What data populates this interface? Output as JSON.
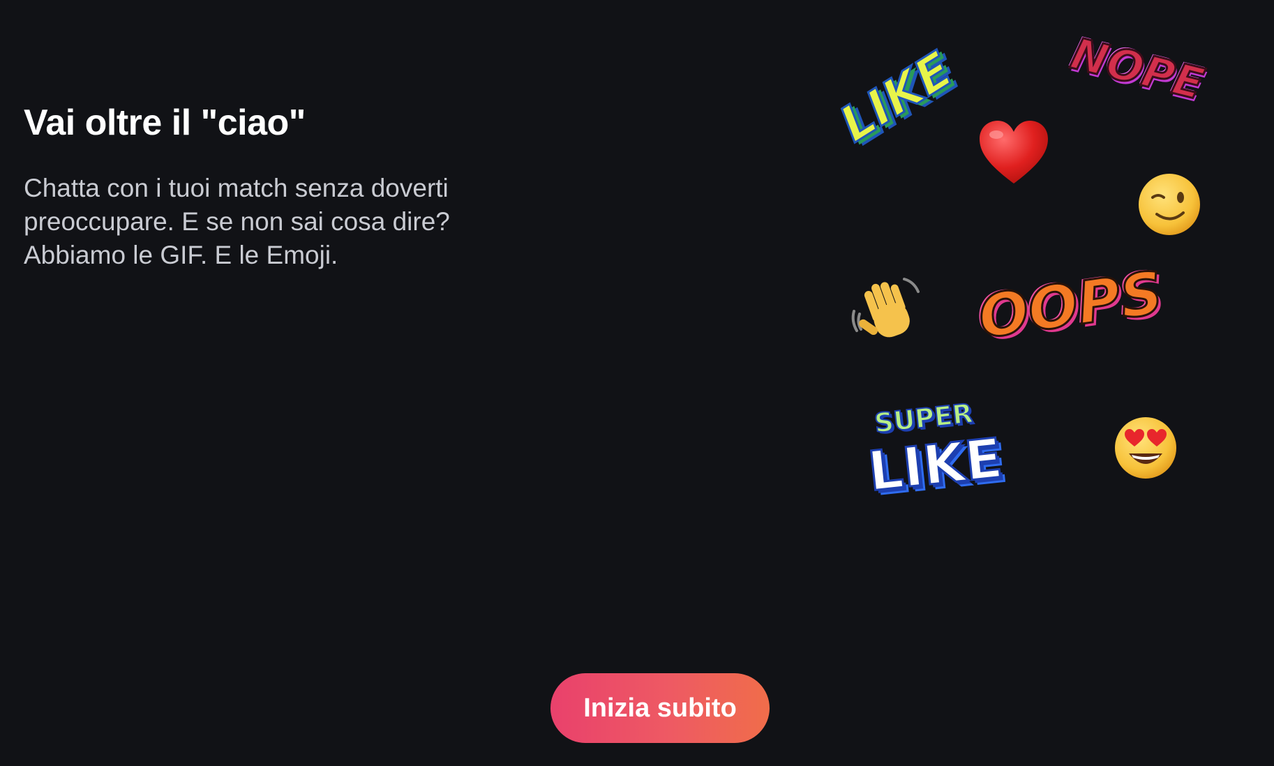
{
  "content": {
    "title": "Vai oltre il \"ciao\"",
    "description_line1": "Chatta con i tuoi match senza doverti",
    "description_line2": "preoccupare. E se non sai cosa dire?",
    "description_line3": "Abbiamo le GIF. E le Emoji."
  },
  "stickers": {
    "like": "LIKE",
    "nope": "NOPE",
    "oops": "OOPS",
    "super": "SUPER",
    "super_like": "LIKE",
    "icons": [
      "heart-icon",
      "wink-face-icon",
      "waving-hand-icon",
      "heart-eyes-face-icon"
    ]
  },
  "cta": {
    "label": "Inizia subito"
  },
  "colors": {
    "background": "#111216",
    "button_gradient_start": "#e9416c",
    "button_gradient_end": "#f06d4a",
    "description_text": "#c9cbd2"
  }
}
